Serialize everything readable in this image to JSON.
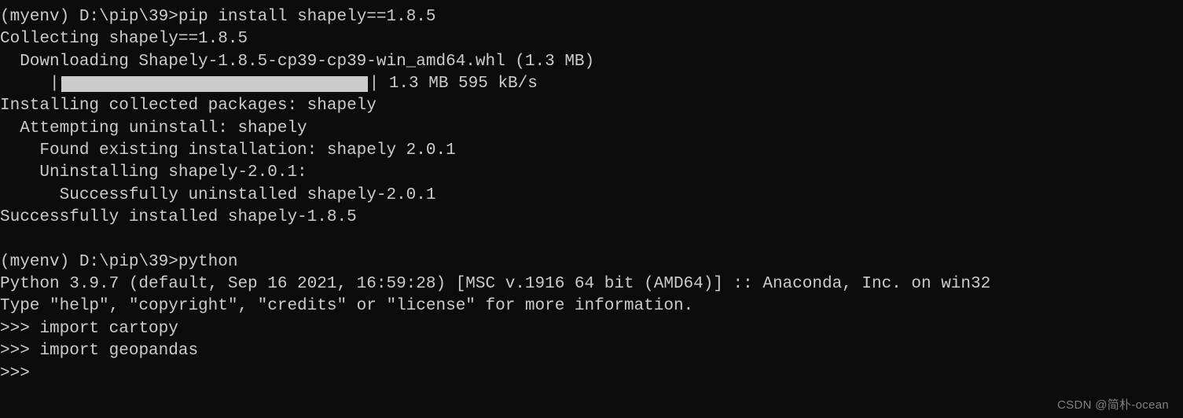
{
  "prompt1": {
    "env": "(myenv)",
    "path": "D:\\pip\\39>",
    "command": "pip install shapely==1.8.5"
  },
  "output": {
    "collecting": "Collecting shapely==1.8.5",
    "downloading": "  Downloading Shapely-1.8.5-cp39-cp39-win_amd64.whl (1.3 MB)",
    "progress_prefix": "     |",
    "progress_suffix": "| 1.3 MB 595 kB/s",
    "installing": "Installing collected packages: shapely",
    "attempting": "  Attempting uninstall: shapely",
    "found": "    Found existing installation: shapely 2.0.1",
    "uninstalling": "    Uninstalling shapely-2.0.1:",
    "uninstalled": "      Successfully uninstalled shapely-2.0.1",
    "success": "Successfully installed shapely-1.8.5"
  },
  "prompt2": {
    "env": "(myenv)",
    "path": "D:\\pip\\39>",
    "command": "python"
  },
  "python": {
    "header": "Python 3.9.7 (default, Sep 16 2021, 16:59:28) [MSC v.1916 64 bit (AMD64)] :: Anaconda, Inc. on win32",
    "help": "Type \"help\", \"copyright\", \"credits\" or \"license\" for more information.",
    "repl1_prompt": ">>> ",
    "repl1_cmd": "import cartopy",
    "repl2_prompt": ">>> ",
    "repl2_cmd": "import geopandas",
    "repl3_prompt": ">>>"
  },
  "watermark": "CSDN @简朴-ocean"
}
